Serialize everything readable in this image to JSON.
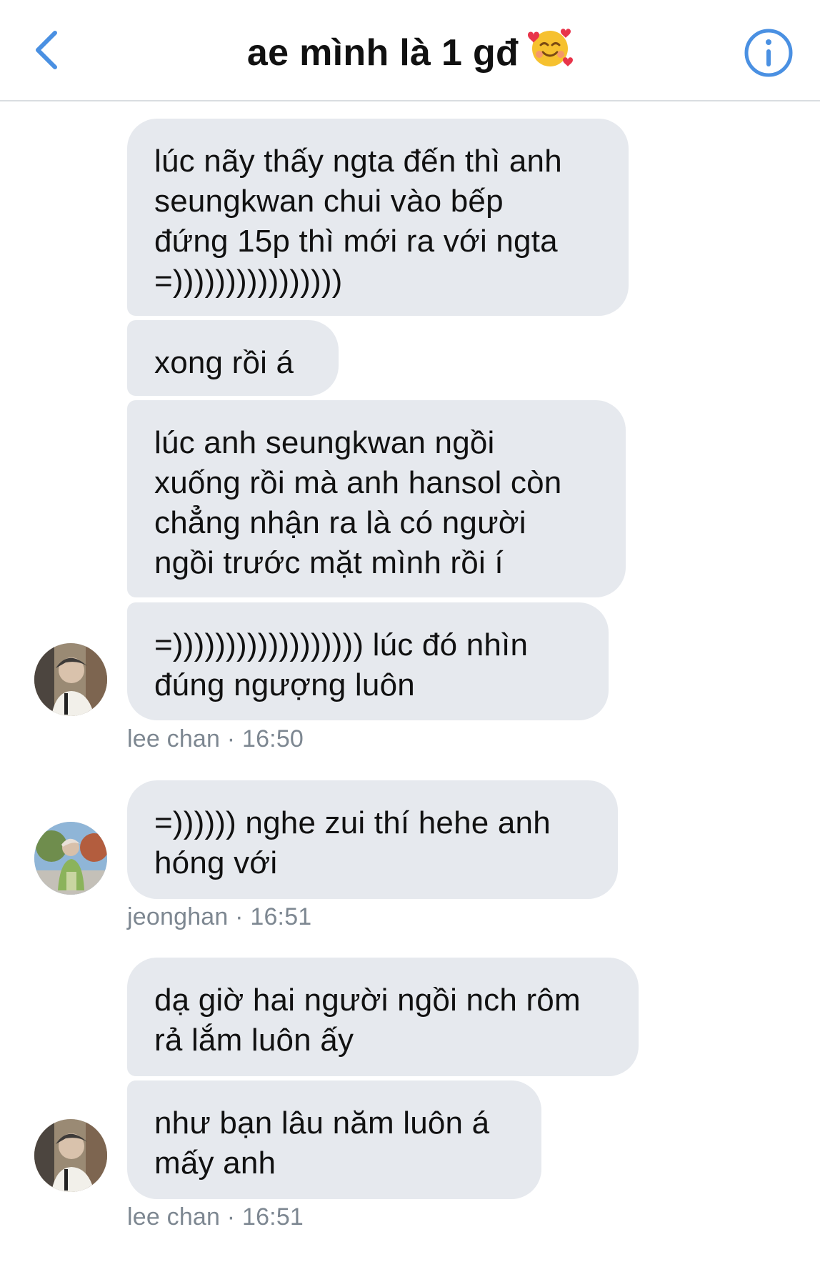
{
  "header": {
    "title": "ae mình là 1 gđ",
    "title_emoji": "smiling-face-with-hearts-icon",
    "back_icon": "chevron-left-icon",
    "info_icon": "info-icon",
    "accent_color": "#4a90e2"
  },
  "messages": [
    {
      "text": "lúc nãy thấy ngta đến thì anh\nseungkwan chui vào bếp\nđứng 15p thì mới ra với ngta\n=))))))))))))))))"
    },
    {
      "text": "xong rồi á"
    },
    {
      "text": "lúc anh seungkwan ngồi\nxuống rồi mà anh hansol còn\nchẳng nhận ra là có người\nngồi trước mặt mình rồi í"
    },
    {
      "text": "=)))))))))))))))))) lúc đó nhìn\nđúng ngượng luôn"
    },
    {
      "text": "=)))))) nghe zui thí hehe anh\nhóng với"
    },
    {
      "text": "dạ giờ hai người ngồi nch rôm\nrả lắm luôn ấy"
    },
    {
      "text": "như bạn lâu năm luôn á\nmấy anh"
    }
  ],
  "meta": [
    {
      "author": "lee chan",
      "time": "16:50",
      "label": "lee chan · 16:50"
    },
    {
      "author": "jeonghan",
      "time": "16:51",
      "label": "jeonghan · 16:51"
    },
    {
      "author": "lee chan",
      "time": "16:51",
      "label": "lee chan · 16:51"
    }
  ],
  "avatars": [
    {
      "name": "lee chan",
      "icon": "avatar-icon"
    },
    {
      "name": "jeonghan",
      "icon": "avatar-icon"
    },
    {
      "name": "lee chan",
      "icon": "avatar-icon"
    }
  ],
  "colors": {
    "bubble": "#e6e9ee",
    "text": "#111111",
    "meta": "#7d8791",
    "divider": "#d9dde1"
  }
}
